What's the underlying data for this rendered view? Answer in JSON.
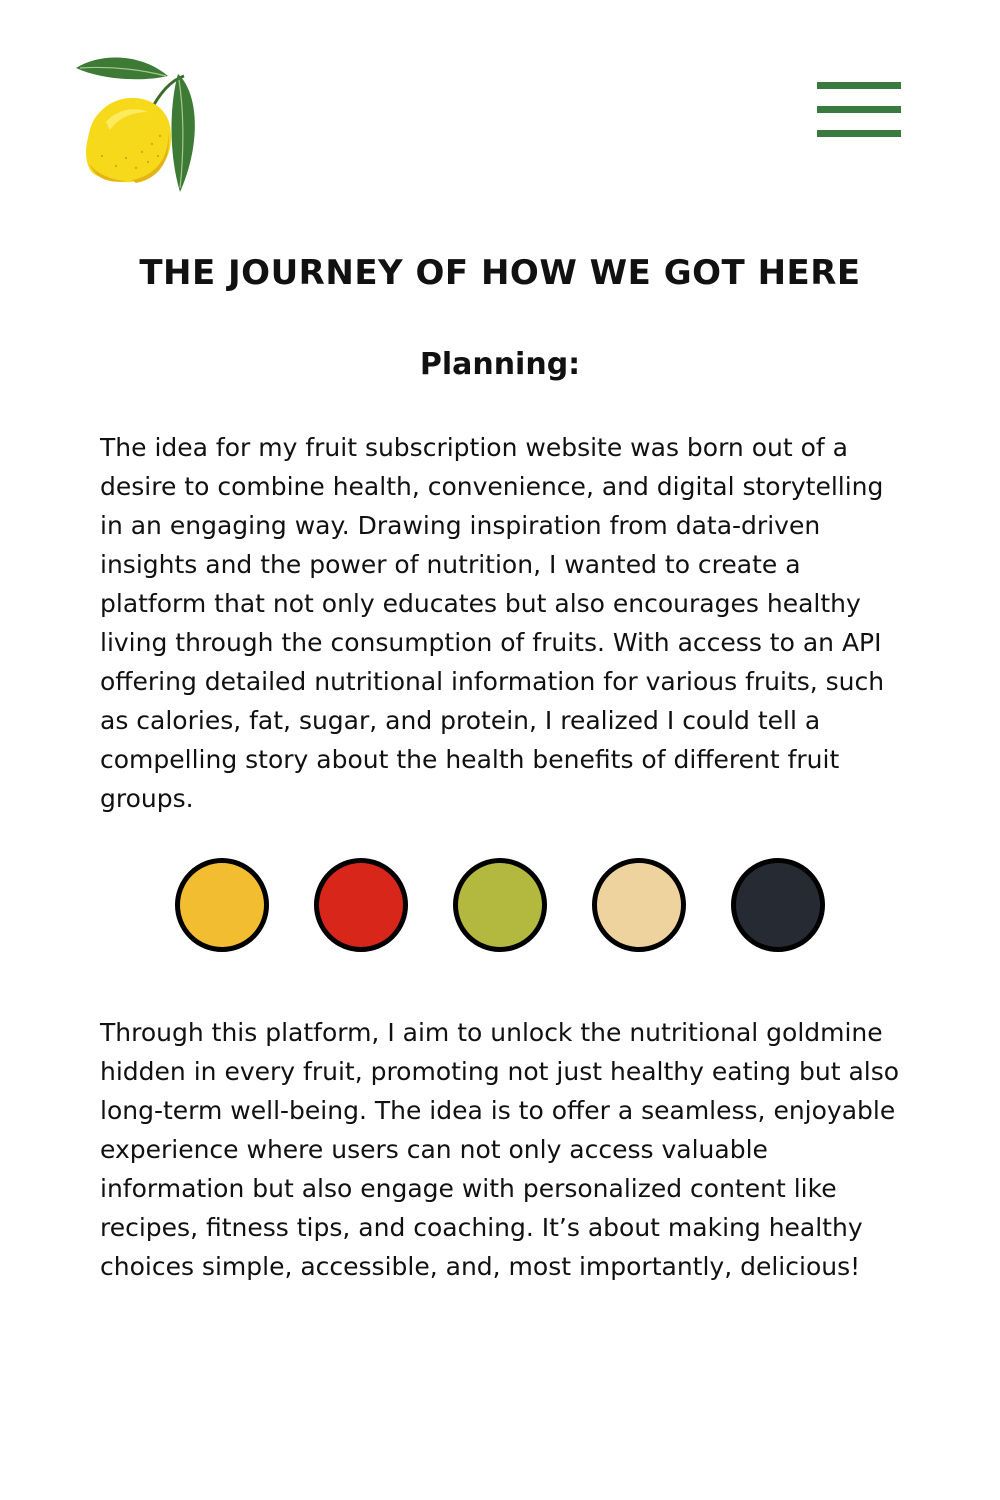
{
  "header": {
    "logo_icon": "lemon-icon",
    "menu_icon": "hamburger-menu-icon",
    "menu_color": "#3a7a3e"
  },
  "main": {
    "title": "THE JOURNEY OF HOW WE GOT HERE",
    "section_heading": "Planning:",
    "paragraph_1": "The idea for my fruit subscription website was born out of a desire to combine health, convenience, and digital storytelling in an engaging way. Drawing inspiration from data-driven insights and the power of nutrition, I wanted to create a platform that not only educates but also encourages healthy living through the consumption of fruits. With access to an API offering detailed nutritional information for various fruits, such as calories, fat, sugar, and protein, I realized I could tell a compelling story about the health benefits of different fruit groups.",
    "color_palette": [
      "#f2bd31",
      "#d8261b",
      "#b3b93e",
      "#efd39f",
      "#262b33"
    ],
    "paragraph_2": "Through this platform, I aim to unlock the nutritional goldmine hidden in every fruit, promoting not just healthy eating but also long-term well-being. The idea is to offer a seamless, enjoyable experience where users can not only access valuable information but also engage with personalized content like recipes, fitness tips, and coaching. It’s about making healthy choices simple, accessible, and, most importantly, delicious!"
  }
}
